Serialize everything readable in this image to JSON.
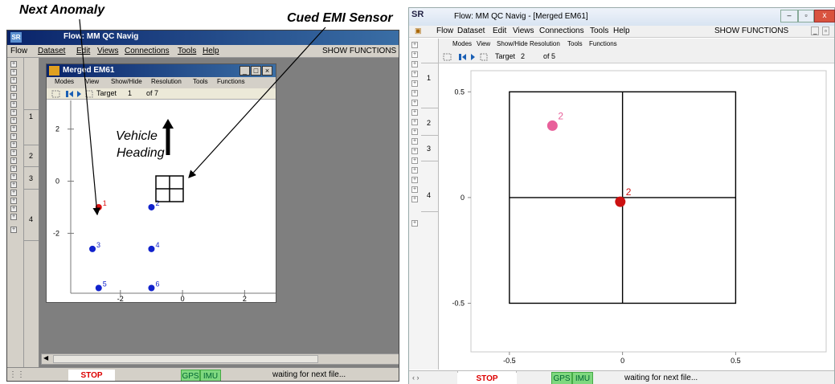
{
  "annotations": {
    "next_anomaly": "Next Anomaly",
    "cued_sensor": "Cued EMI Sensor",
    "vehicle": "Vehicle",
    "heading": "Heading"
  },
  "left": {
    "title": "Flow: MM QC Navig",
    "app_icon": "SR",
    "menu": [
      "Flow",
      "Dataset",
      "Edit",
      "Views",
      "Connections",
      "Tools",
      "Help"
    ],
    "show_functions": "SHOW FUNCTIONS",
    "side_numbers": [
      "1",
      "2",
      "3",
      "4"
    ],
    "status": {
      "stop": "STOP",
      "gps": "GPS",
      "imu": "IMU",
      "msg": "waiting for next file..."
    },
    "inner": {
      "title": "Merged EM61",
      "menu": [
        "Modes",
        "View",
        "Show/Hide",
        "Resolution",
        "Tools",
        "Functions"
      ],
      "target_label": "Target",
      "target_value": "1",
      "target_total": "of 7",
      "y_ticks": [
        "2",
        "0",
        "-2"
      ],
      "x_ticks": [
        "-2",
        "0",
        "2"
      ],
      "points": [
        {
          "label": "1",
          "x": -2.7,
          "y": -1.0,
          "color": "#dd1111"
        },
        {
          "label": "2",
          "x": -1.0,
          "y": -1.0,
          "color": "#1122cc"
        },
        {
          "label": "3",
          "x": -2.9,
          "y": -2.6,
          "color": "#1122cc"
        },
        {
          "label": "4",
          "x": -1.0,
          "y": -2.6,
          "color": "#1122cc"
        },
        {
          "label": "5",
          "x": -2.7,
          "y": -4.1,
          "color": "#1122cc"
        },
        {
          "label": "6",
          "x": -1.0,
          "y": -4.1,
          "color": "#1122cc"
        }
      ]
    }
  },
  "right": {
    "title": "Flow: MM QC Navig - [Merged EM61]",
    "app_icon": "SR",
    "menu": [
      "Flow",
      "Dataset",
      "Edit",
      "Views",
      "Connections",
      "Tools",
      "Help"
    ],
    "show_functions": "SHOW FUNCTIONS",
    "modes": [
      "Modes",
      "View",
      "Show/Hide",
      "Resolution",
      "Tools",
      "Functions"
    ],
    "target_label": "Target",
    "target_value": "2",
    "target_total": "of 5",
    "side_numbers": [
      "1",
      "2",
      "3",
      "4"
    ],
    "status": {
      "stop": "STOP",
      "gps": "GPS",
      "imu": "IMU",
      "msg": "waiting for next file..."
    }
  },
  "chart_data": {
    "type": "scatter",
    "title": "",
    "xlabel": "",
    "ylabel": "",
    "xlim": [
      -0.67,
      0.9
    ],
    "ylim": [
      -0.73,
      0.6
    ],
    "x_ticks": [
      "-0.5",
      "0",
      "0.5"
    ],
    "y_ticks": [
      "0.5",
      "0",
      "-0.5"
    ],
    "x_tick_values": [
      -0.5,
      0,
      0.5
    ],
    "y_tick_values": [
      0.5,
      0,
      -0.5
    ],
    "sensor_box": [
      -0.5,
      0.5,
      -0.5,
      0.5
    ],
    "points": [
      {
        "label": "2",
        "x": -0.31,
        "y": 0.34,
        "color": "#e8609a"
      },
      {
        "label": "2",
        "x": -0.01,
        "y": -0.02,
        "color": "#cc1111"
      }
    ]
  }
}
